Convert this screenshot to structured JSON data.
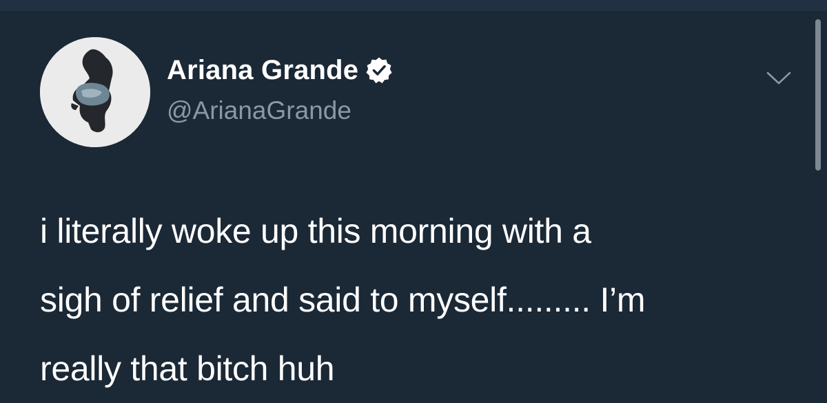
{
  "author": {
    "display_name": "Ariana Grande",
    "handle": "@ArianaGrande",
    "verified": true,
    "avatar": "avatar-photo"
  },
  "tweet": {
    "text": "i literally woke up this morning with a\nsigh of relief and said to myself......... I’m\nreally that bitch huh"
  },
  "icons": {
    "verified": "verified-badge-icon",
    "menu": "chevron-down-icon"
  },
  "colors": {
    "background": "#1b2836",
    "name": "#ffffff",
    "handle": "#8899a6",
    "text": "#ffffff",
    "verified_badge": "#ffffff"
  }
}
